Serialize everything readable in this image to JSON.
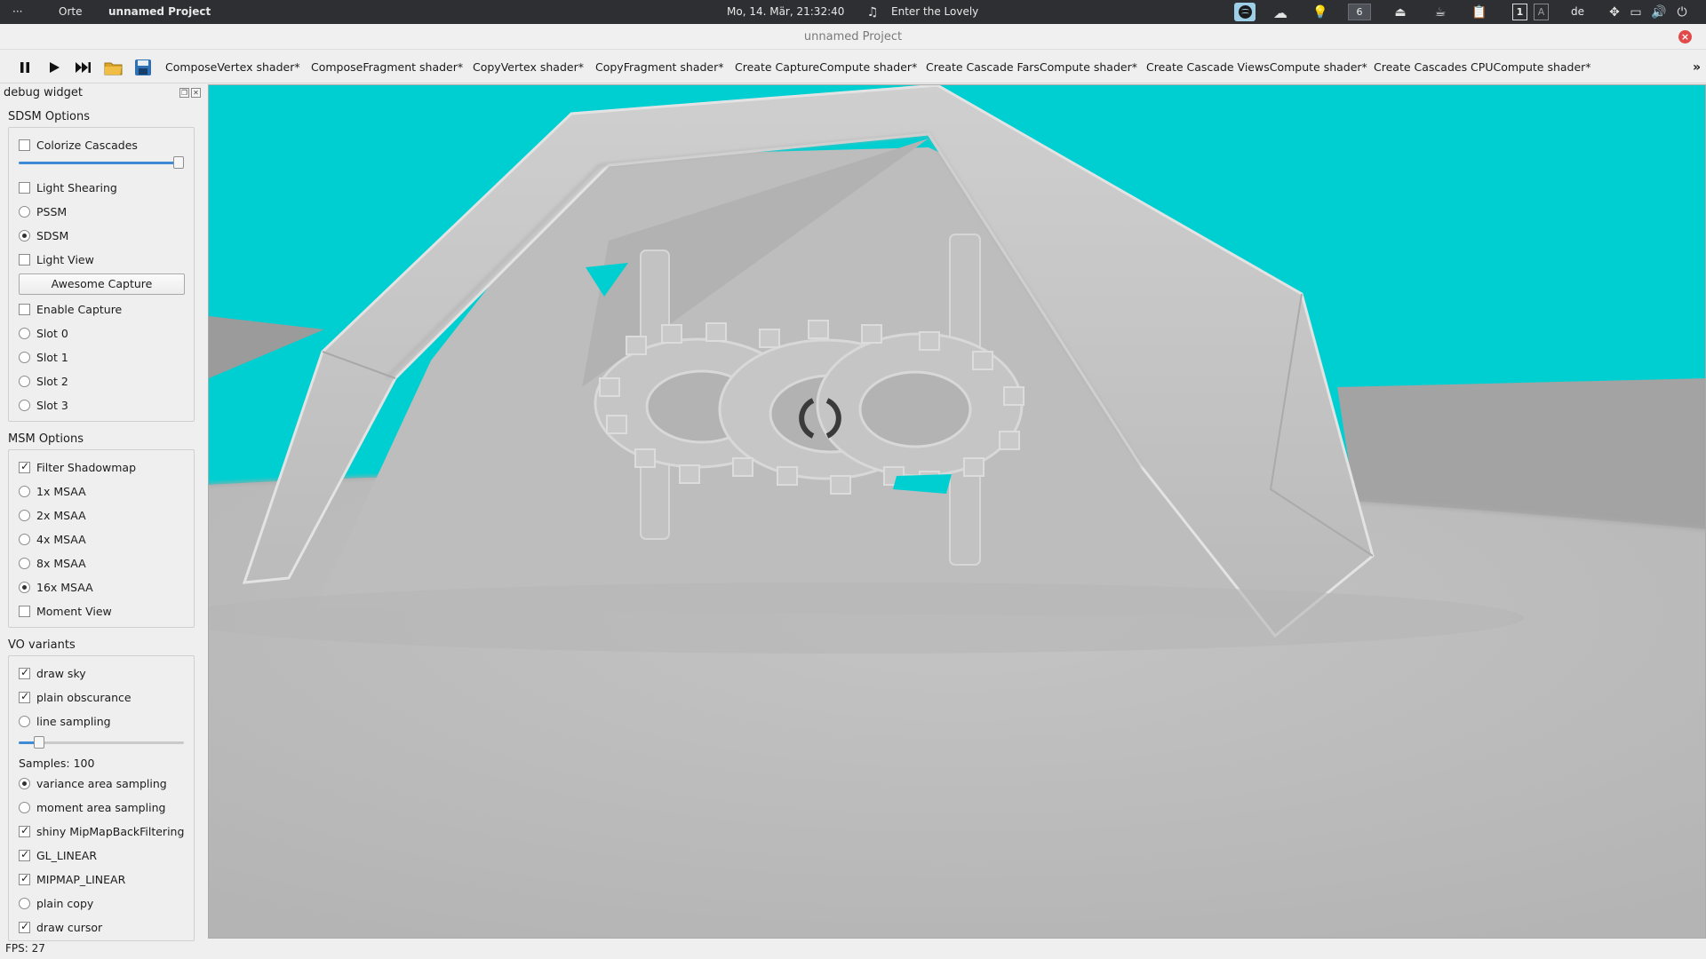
{
  "system_bar": {
    "menu_dots": "···",
    "places": "Orte",
    "active_window": "unnamed Project",
    "clock": "Mo, 14. Mär, 21:32:40",
    "now_playing": "Enter the Lovely",
    "workspace_number": "6",
    "keyboard_layout": "de",
    "workspace_indicator_a": "1",
    "workspace_indicator_b": "A"
  },
  "window": {
    "title": "unnamed Project"
  },
  "toolbar": {
    "tabs": [
      "ComposeVertex shader*",
      "ComposeFragment shader*",
      "CopyVertex shader*",
      "CopyFragment shader*",
      "Create CaptureCompute shader*",
      "Create Cascade FarsCompute shader*",
      "Create Cascade ViewsCompute shader*",
      "Create Cascades CPUCompute shader*"
    ],
    "overflow": "»"
  },
  "dock": {
    "title": "debug widget",
    "sdsm": {
      "title": "SDSM Options",
      "colorize_cascades": {
        "label": "Colorize Cascades",
        "checked": false
      },
      "slider_value": 1.0,
      "light_shearing": {
        "label": "Light Shearing",
        "checked": false
      },
      "pssm": {
        "label": "PSSM",
        "selected": false
      },
      "sdsm": {
        "label": "SDSM",
        "selected": true
      },
      "light_view": {
        "label": "Light View",
        "checked": false
      },
      "awesome_capture": "Awesome Capture",
      "enable_capture": {
        "label": "Enable Capture",
        "checked": false
      },
      "slot0": {
        "label": "Slot 0",
        "selected": false
      },
      "slot1": {
        "label": "Slot 1",
        "selected": false
      },
      "slot2": {
        "label": "Slot 2",
        "selected": false
      },
      "slot3": {
        "label": "Slot 3",
        "selected": false
      }
    },
    "msm": {
      "title": "MSM Options",
      "filter_shadowmap": {
        "label": "Filter Shadowmap",
        "checked": true
      },
      "msaa1": {
        "label": "1x MSAA",
        "selected": false
      },
      "msaa2": {
        "label": "2x MSAA",
        "selected": false
      },
      "msaa4": {
        "label": "4x MSAA",
        "selected": false
      },
      "msaa8": {
        "label": "8x MSAA",
        "selected": false
      },
      "msaa16": {
        "label": "16x MSAA",
        "selected": true
      },
      "moment_view": {
        "label": "Moment View",
        "checked": false
      }
    },
    "vo": {
      "title": "VO variants",
      "draw_sky": {
        "label": "draw sky",
        "checked": true
      },
      "plain_obscurance": {
        "label": "plain obscurance",
        "checked": true
      },
      "line_sampling": {
        "label": "line sampling",
        "selected": false
      },
      "samples_slider_value": 0.1,
      "samples_label": "Samples: 100",
      "variance_area_sampling": {
        "label": "variance area sampling",
        "selected": true
      },
      "moment_area_sampling": {
        "label": "moment area sampling",
        "selected": false
      },
      "shiny_mipmap": {
        "label": "shiny MipMapBackFiltering",
        "checked": true
      },
      "gl_linear": {
        "label": "GL_LINEAR",
        "checked": true
      },
      "mipmap_linear": {
        "label": "MIPMAP_LINEAR",
        "checked": true
      },
      "plain_copy": {
        "label": "plain copy",
        "selected": false
      },
      "draw_cursor": {
        "label": "draw cursor",
        "checked": true
      }
    }
  },
  "status": {
    "fps": "FPS: 27"
  },
  "colors": {
    "sky": "#00cfd1",
    "geometry": "#bdbdbd",
    "slider_accent": "#3f8ad6",
    "topbar_bg": "#2d2f33"
  }
}
